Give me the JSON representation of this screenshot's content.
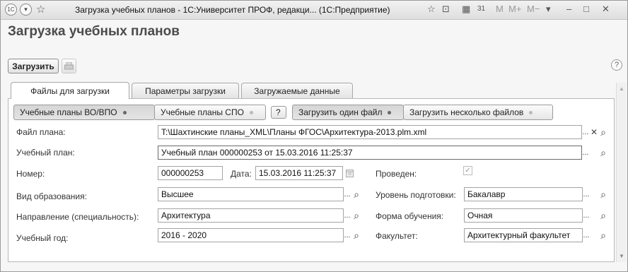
{
  "window": {
    "title": "Загрузка учебных планов - 1С:Университет ПРОФ, редакци... (1С:Предприятие)",
    "app_icon": "1С",
    "right_controls": [
      "☆",
      "⊡",
      "▦",
      "31",
      "M",
      "M+",
      "M−",
      "▾",
      "–",
      "□",
      "✕"
    ]
  },
  "form": {
    "heading": "Загрузка учебных планов",
    "load_button": "Загрузить",
    "help_glyph": "?"
  },
  "tabs": [
    "Файлы для загрузки",
    "Параметры загрузки",
    "Загружаемые данные"
  ],
  "mode_buttons": {
    "vo": "Учебные планы ВО/ВПО",
    "spo": "Учебные планы СПО",
    "q": "?",
    "one": "Загрузить один файл",
    "many": "Загрузить несколько файлов"
  },
  "fields": {
    "file_label": "Файл плана:",
    "file_value": "T:\\Шахтинские планы_XML\\Планы ФГОС\\Архитектура-2013.plm.xml",
    "plan_label": "Учебный план:",
    "plan_value": "Учебный план 000000253 от 15.03.2016 11:25:37",
    "number_label": "Номер:",
    "number_value": "000000253",
    "date_label": "Дата:",
    "date_value": "15.03.2016 11:25:37",
    "posted_label": "Проведен:",
    "posted_checked": true,
    "edu_type_label": "Вид образования:",
    "edu_type_value": "Высшее",
    "level_label": "Уровень подготовки:",
    "level_value": "Бакалавр",
    "direction_label": "Направление (специальность):",
    "direction_value": "Архитектура",
    "study_form_label": "Форма обучения:",
    "study_form_value": "Очная",
    "year_label": "Учебный год:",
    "year_value": "2016 - 2020",
    "faculty_label": "Факультет:",
    "faculty_value": "Архитектурный факультет"
  },
  "glyphs": {
    "ellipsis": "...",
    "clear": "✕",
    "search": "⌕"
  }
}
